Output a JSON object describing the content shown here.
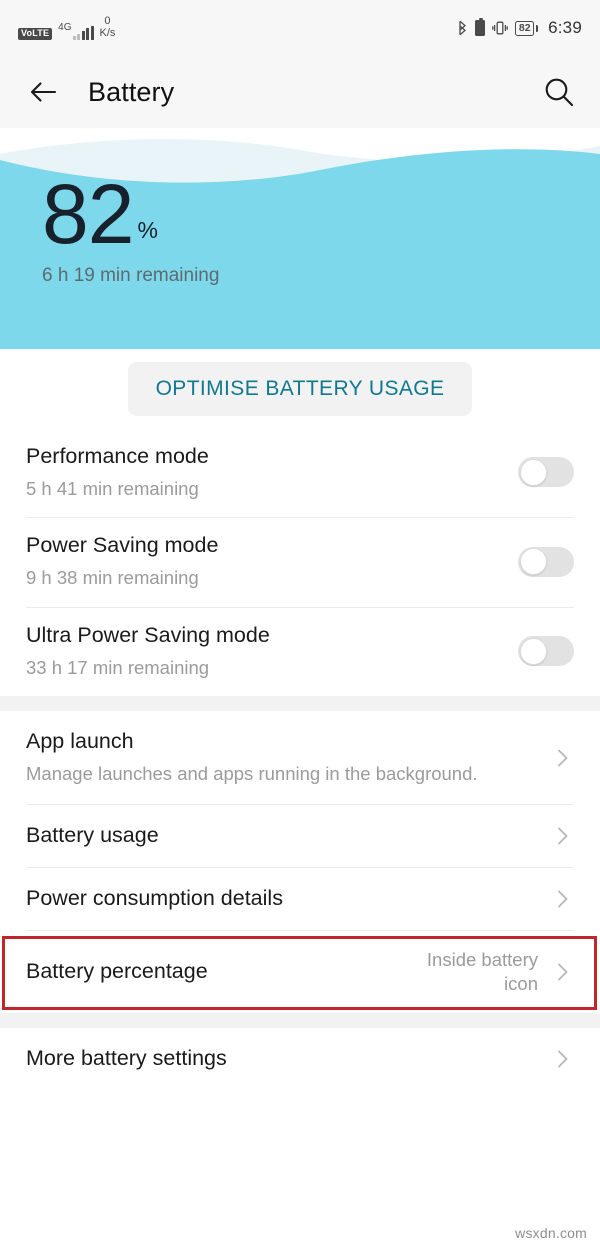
{
  "status_bar": {
    "volte_label": "VoLTE",
    "network_label": "4G",
    "data_rate_value": "0",
    "data_rate_unit": "K/s",
    "battery_percent": "82",
    "time": "6:39",
    "icons": [
      "volte-badge",
      "signal-bars-icon",
      "bluetooth-icon",
      "battery-small-icon",
      "vibrate-icon",
      "battery-percent-icon"
    ]
  },
  "app_bar": {
    "back_icon": "back-arrow-icon",
    "title": "Battery",
    "search_icon": "search-icon"
  },
  "hero": {
    "percent": "82",
    "percent_sign": "%",
    "remaining": "6 h 19 min remaining",
    "wave_color": "#7dd8ec",
    "wave_back_color": "#e8f4f8"
  },
  "optimise_button": {
    "label": "OPTIMISE BATTERY USAGE",
    "text_color": "#10798f",
    "background_color": "#f2f2f2"
  },
  "modes": [
    {
      "title": "Performance mode",
      "subtitle": "5 h 41 min remaining",
      "toggle_state": "off"
    },
    {
      "title": "Power Saving mode",
      "subtitle": "9 h 38 min remaining",
      "toggle_state": "off"
    },
    {
      "title": "Ultra Power Saving mode",
      "subtitle": "33 h 17 min remaining",
      "toggle_state": "off"
    }
  ],
  "settings": [
    {
      "title": "App launch",
      "subtitle": "Manage launches and apps running in the background.",
      "value": "",
      "chevron": true
    },
    {
      "title": "Battery usage",
      "subtitle": "",
      "value": "",
      "chevron": true,
      "highlighted": true
    },
    {
      "title": "Power consumption details",
      "subtitle": "",
      "value": "",
      "chevron": true
    },
    {
      "title": "Battery percentage",
      "subtitle": "",
      "value": "Inside battery icon",
      "chevron": true
    }
  ],
  "more_settings": {
    "title": "More battery settings",
    "chevron": true
  },
  "highlight": {
    "border_color": "#c0272d"
  },
  "watermark": "wsxdn.com"
}
